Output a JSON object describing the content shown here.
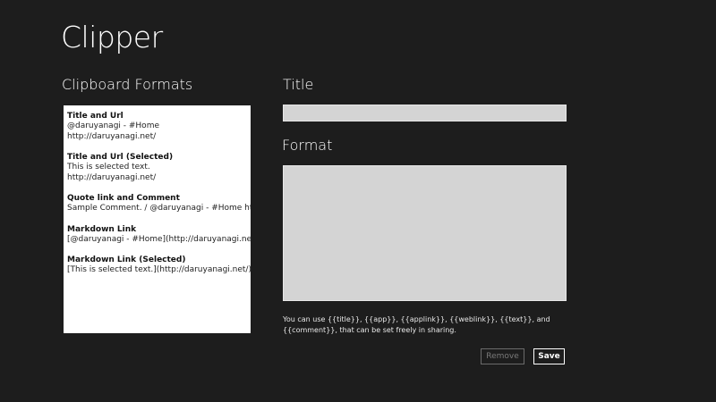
{
  "app": {
    "title": "Clipper"
  },
  "formats_panel": {
    "label": "Clipboard Formats",
    "items": [
      {
        "name": "Title and Url",
        "lines": [
          "@daruyanagi - #Home",
          "http://daruyanagi.net/"
        ]
      },
      {
        "name": "Title and Url (Selected)",
        "lines": [
          "This is selected text.",
          "http://daruyanagi.net/"
        ]
      },
      {
        "name": "Quote link and Comment",
        "lines": [
          "Sample Comment. / @daruyanagi - #Home http://daruyanagi.net/"
        ]
      },
      {
        "name": "Markdown Link",
        "lines": [
          "[@daruyanagi - #Home](http://daruyanagi.net/)"
        ]
      },
      {
        "name": "Markdown Link (Selected)",
        "lines": [
          "[This is selected text.](http://daruyanagi.net/)"
        ]
      }
    ]
  },
  "editor": {
    "title_label": "Title",
    "title_value": "",
    "format_label": "Format",
    "format_value": "",
    "hint": "You can use {{title}}, {{app}}, {{applink}}, {{weblink}}, {{text}}, and {{comment}}, that can be set freely in sharing."
  },
  "buttons": {
    "remove_label": "Remove",
    "save_label": "Save"
  }
}
